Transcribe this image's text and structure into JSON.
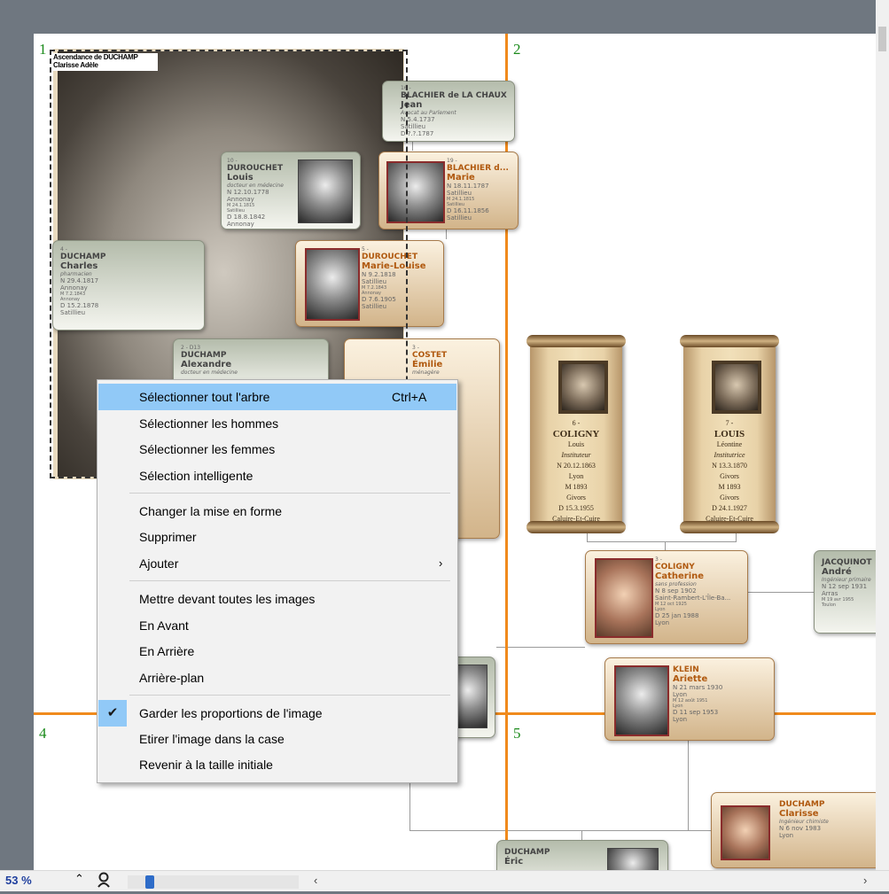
{
  "page_numbers": [
    "1",
    "2",
    "4",
    "5"
  ],
  "selection": {
    "title": "Ascendance de DUCHAMP Clarisse Adèle"
  },
  "cards": {
    "blachier_jean": {
      "num": "16 -",
      "surname": "BLACHIER de LA CHAUX",
      "given": "Jean",
      "occupation": "Avocat au Parlement",
      "l1": "N 5.4.1737",
      "l2": "Satillieu",
      "l3": "D ?.?.1787"
    },
    "durouchet_louis": {
      "num": "10 -",
      "surname": "DUROUCHET",
      "given": "Louis",
      "occupation": "docteur en médecine",
      "l1": "N 12.10.1778",
      "l2": "Annonay",
      "l3": "M 24.1.1815",
      "l4": "Satillieu",
      "l5": "D 18.8.1842",
      "l6": "Annonay"
    },
    "blachier_marie": {
      "num": "19 -",
      "surname": "BLACHIER d...",
      "given": "Marie",
      "l1": "N 18.11.1787",
      "l2": "Satillieu",
      "l3": "M 24.1.1815",
      "l4": "Satillieu",
      "l5": "D 16.11.1856",
      "l6": "Satillieu"
    },
    "duchamp_charles": {
      "num": "4 -",
      "surname": "DUCHAMP",
      "given": "Charles",
      "occupation": "pharmacien",
      "l1": "N 29.4.1817",
      "l2": "Annonay",
      "l3": "M 7.2.1843",
      "l4": "Annonay",
      "l5": "D 15.2.1878",
      "l6": "Satillieu"
    },
    "durouchet_marie": {
      "num": "5 -",
      "surname": "DUROUCHET",
      "given": "Marie-Louise",
      "l1": "N 9.2.1818",
      "l2": "Satillieu",
      "l3": "M 7.2.1843",
      "l4": "Annonay",
      "l5": "D 7.6.1905",
      "l6": "Satillieu"
    },
    "duchamp_alexandre": {
      "num": "2 - D13",
      "surname": "DUCHAMP",
      "given": "Alexandre",
      "occupation": "docteur en médecine"
    },
    "costet_emilie": {
      "num": "3 -",
      "surname": "COSTET",
      "given": "Émilie",
      "occupation": "ménagère"
    },
    "coligny_catherine": {
      "num": "3 -",
      "surname": "COLIGNY",
      "given": "Catherine",
      "occupation": "sans profession",
      "l1": "N 8 sep 1902",
      "l2": "Saint-Rambert-L'Île-Ba...",
      "l3": "M 12 oct 1925",
      "l4": "Lyon",
      "l5": "D 25 jan 1988",
      "l6": "Lyon"
    },
    "jacquinot_andre": {
      "surname": "JACQUINOT",
      "given": "André",
      "occupation": "Ingénieur primaire",
      "l1": "N 12 sep 1931",
      "l2": "Arras",
      "l3": "M 19 avr 1955",
      "l4": "Toulon"
    },
    "klein_ariette": {
      "surname": "KLEIN",
      "given": "Ariette",
      "l1": "N 21 mars 1930",
      "l2": "Lyon",
      "l3": "M 12 août 1951",
      "l4": "Lyon",
      "l5": "D 11 sep 1953",
      "l6": "Lyon"
    },
    "duchamp_clarisse": {
      "surname": "DUCHAMP",
      "given": "Clarisse",
      "occupation": "Ingénieur chimiste",
      "l1": "N 6 nov 1983",
      "l2": "Lyon"
    },
    "duchamp_eric": {
      "surname": "DUCHAMP",
      "given": "Éric"
    }
  },
  "scrolls": {
    "coligny_louis": {
      "num": "6 -",
      "surname": "COLIGNY",
      "given": "Louis",
      "occupation": "Instituteur",
      "l1": "N 20.12.1863",
      "l2": "Lyon",
      "l3": "M 1893",
      "l4": "Givors",
      "l5": "D 15.3.1955",
      "l6": "Caluire-Et-Cuire"
    },
    "louis_leontine": {
      "num": "7 -",
      "surname": "LOUIS",
      "given": "Léontine",
      "occupation": "Institutrice",
      "l1": "N 13.3.1870",
      "l2": "Givors",
      "l3": "M 1893",
      "l4": "Givors",
      "l5": "D 24.1.1927",
      "l6": "Caluire-Et-Cuire"
    }
  },
  "context_menu": {
    "select_all": {
      "label": "Sélectionner tout l'arbre",
      "shortcut": "Ctrl+A"
    },
    "select_men": "Sélectionner les hommes",
    "select_women": "Sélectionner les femmes",
    "smart_select": "Sélection intelligente",
    "change_layout": "Changer la mise en forme",
    "delete": "Supprimer",
    "add": "Ajouter",
    "bring_front_all": "Mettre devant toutes les images",
    "forward": "En Avant",
    "backward": "En Arrière",
    "background": "Arrière-plan",
    "keep_proportions": "Garder les proportions de l'image",
    "stretch": "Etirer l'image dans la case",
    "reset_size": "Revenir à la taille initiale"
  },
  "statusbar": {
    "zoom": "53 %"
  },
  "colors": {
    "page_divider": "#f08a1c",
    "menu_highlight": "#91c9f7",
    "page_number": "#1a8a1a"
  }
}
